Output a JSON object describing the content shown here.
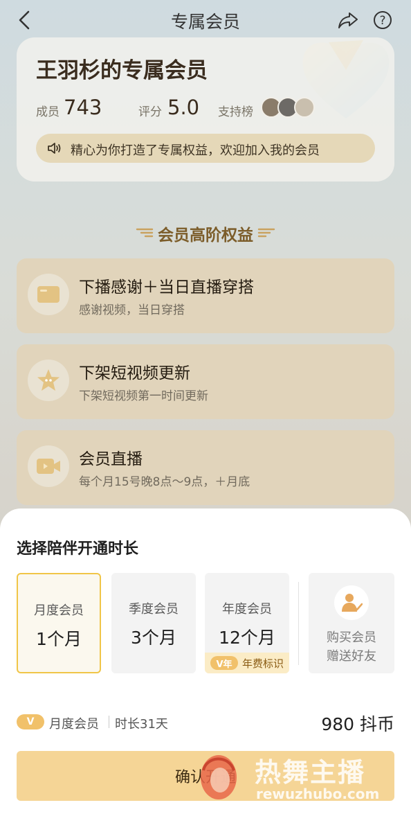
{
  "header": {
    "title": "专属会员",
    "back_icon": "chevron-left-icon",
    "share_icon": "share-icon",
    "help_icon": "help-circle-icon"
  },
  "member_card": {
    "title": "王羽杉的专属会员",
    "members_label": "成员",
    "members_count": "743",
    "rating_label": "评分",
    "rating_value": "5.0",
    "support_label": "支持榜",
    "notice": "精心为你打造了专属权益，欢迎加入我的会员"
  },
  "benefits": {
    "title": "会员高阶权益",
    "items": [
      {
        "title": "下播感谢＋当日直播穿搭",
        "desc": "感谢视频，当日穿搭",
        "icon": "card-icon"
      },
      {
        "title": "下架短视频更新",
        "desc": "下架短视频第一时间更新",
        "icon": "star-icon"
      },
      {
        "title": "会员直播",
        "desc": "每个月15号晚8点～9点，＋月底",
        "icon": "live-video-icon"
      }
    ]
  },
  "sheet": {
    "title": "选择陪伴开通时长",
    "plans": [
      {
        "name": "月度会员",
        "duration": "1个月",
        "selected": true
      },
      {
        "name": "季度会员",
        "duration": "3个月",
        "selected": false
      },
      {
        "name": "年度会员",
        "duration": "12个月",
        "selected": false,
        "badge_tag": "V年",
        "badge_text": "年费标识"
      }
    ],
    "gift": {
      "line1": "购买会员",
      "line2": "赠送好友",
      "icon": "gift-user-icon"
    },
    "summary": {
      "tag": "V",
      "plan": "月度会员",
      "duration": "时长31天",
      "price": "980 抖币"
    },
    "confirm_label": "确认开通"
  },
  "watermark": {
    "text": "热舞主播",
    "domain": "rewuzhubo.com"
  },
  "colors": {
    "accent_gold": "#f0c547",
    "button_bg": "#f5d596",
    "badge_tag": "#f1c16a"
  }
}
